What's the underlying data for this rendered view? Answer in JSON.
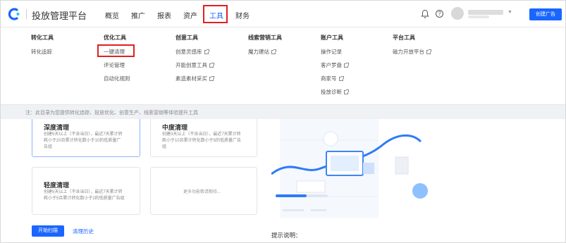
{
  "brand": {
    "name": "投放管理平台"
  },
  "nav": {
    "items": [
      {
        "label": "概览"
      },
      {
        "label": "推广"
      },
      {
        "label": "报表"
      },
      {
        "label": "资产"
      },
      {
        "label": "工具"
      },
      {
        "label": "财务"
      }
    ],
    "active": "工具",
    "create_label": "创建广告"
  },
  "menu": {
    "columns": [
      {
        "heading": "转化工具",
        "items": [
          {
            "label": "转化追踪",
            "external": false
          }
        ]
      },
      {
        "heading": "优化工具",
        "items": [
          {
            "label": "一键清理",
            "external": false
          },
          {
            "label": "评论管理",
            "external": false
          },
          {
            "label": "自动化规则",
            "external": false
          }
        ]
      },
      {
        "heading": "创意工具",
        "items": [
          {
            "label": "创意灵感库",
            "external": true
          },
          {
            "label": "开能创意工具",
            "external": true
          },
          {
            "label": "素造素材采买",
            "external": true
          }
        ]
      },
      {
        "heading": "线索营销工具",
        "items": [
          {
            "label": "魔力建站",
            "external": true
          }
        ]
      },
      {
        "heading": "账户工具",
        "items": [
          {
            "label": "操作记录",
            "external": false
          },
          {
            "label": "客户罗盘",
            "external": true
          },
          {
            "label": "商家号",
            "external": true
          },
          {
            "label": "投放诊断",
            "external": true
          }
        ]
      },
      {
        "heading": "平台工具",
        "items": [
          {
            "label": "磁力开放平台",
            "external": true
          }
        ]
      }
    ],
    "note": "注：此目录为您提供转化追踪、投放优化、创意生产、线索营销等体验提升工具"
  },
  "cleanup": {
    "cards": [
      {
        "title": "深度清理",
        "desc": "创建5天以上（不含当日），最近7天累计转耗小于20且累计转化数小于10的低质量广告组"
      },
      {
        "title": "中度清理",
        "desc": "创建3天以上（不含当日），最近7天累计转耗小于10且累计转化数小于5的低质量广告组"
      },
      {
        "title": "轻度清理",
        "desc": "创建5天以上（不含当日），最近7天累计转耗小于5且累计转化数小于2的低质量广告组"
      },
      {
        "more": "更多功能敬请期待..."
      }
    ],
    "start_label": "开始扫描",
    "history_label": "清理历史",
    "tips_label": "提示说明："
  },
  "colors": {
    "accent": "#1a66ff",
    "highlight": "#e02020"
  }
}
